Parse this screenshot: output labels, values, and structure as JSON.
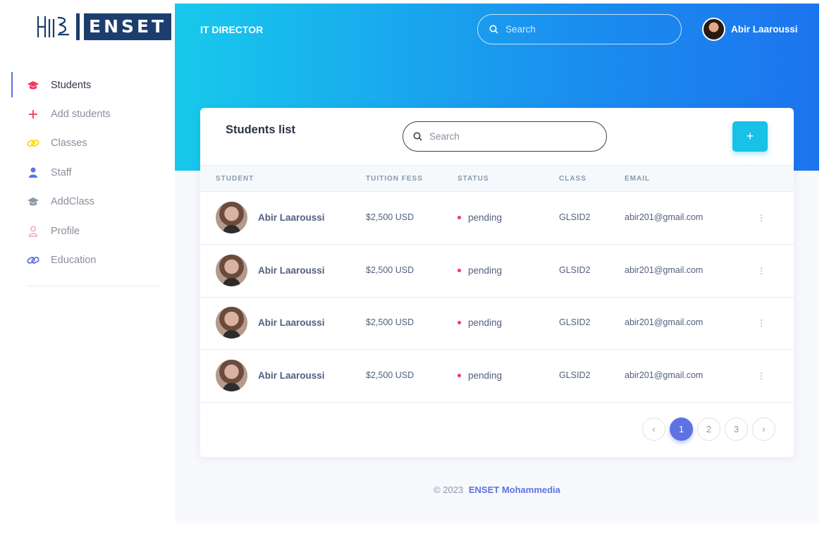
{
  "sidebar": {
    "logo_text": "ENSET",
    "items": [
      {
        "label": "Students",
        "icon": "graduation-cap-icon",
        "color": "#f5365c"
      },
      {
        "label": "Add students",
        "icon": "plus-icon",
        "color": "#f5365c"
      },
      {
        "label": "Classes",
        "icon": "link-icon",
        "color": "#ffd600"
      },
      {
        "label": "Staff",
        "icon": "user-icon",
        "color": "#5e72e4"
      },
      {
        "label": "AddClass",
        "icon": "graduation-cap-icon",
        "color": "#8898aa"
      },
      {
        "label": "Profile",
        "icon": "person-outline-icon",
        "color": "#f3a4b5"
      },
      {
        "label": "Education",
        "icon": "link-icon",
        "color": "#5e72e4"
      }
    ]
  },
  "header": {
    "brand": "IT DIRECTOR",
    "search_placeholder": "Search",
    "user_name": "Abir Laaroussi"
  },
  "card": {
    "title": "Students list",
    "search_placeholder": "Search",
    "add_label": "+",
    "columns": [
      "STUDENT",
      "TUITION FESS",
      "STATUS",
      "CLASS",
      "EMAIL"
    ],
    "rows": [
      {
        "name": "Abir Laaroussi",
        "fee": "$2,500 USD",
        "status": "pending",
        "class": "GLSID2",
        "email": "abir201@gmail.com"
      },
      {
        "name": "Abir Laaroussi",
        "fee": "$2,500 USD",
        "status": "pending",
        "class": "GLSID2",
        "email": "abir201@gmail.com"
      },
      {
        "name": "Abir Laaroussi",
        "fee": "$2,500 USD",
        "status": "pending",
        "class": "GLSID2",
        "email": "abir201@gmail.com"
      },
      {
        "name": "Abir Laaroussi",
        "fee": "$2,500 USD",
        "status": "pending",
        "class": "GLSID2",
        "email": "abir201@gmail.com"
      }
    ],
    "pagination": {
      "prev": "‹",
      "pages": [
        "1",
        "2",
        "3"
      ],
      "active": "1",
      "next": "›"
    }
  },
  "footer": {
    "copyright": "© 2023",
    "org": "ENSET Mohammedia"
  },
  "colors": {
    "accent": "#5e72e4",
    "header_start": "#18c9ec",
    "header_end": "#1c74ee",
    "status_pending": "#f5365c"
  }
}
